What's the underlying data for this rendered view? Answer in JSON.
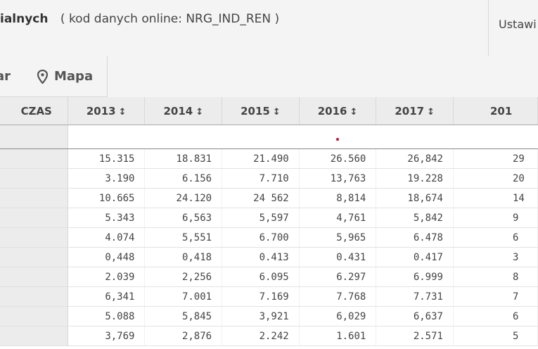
{
  "header": {
    "dataset_name": "ialnych",
    "dataset_code": "( kod danych online: NRG_IND_REN )",
    "settings_label": "Ustawi"
  },
  "toolbar": {
    "prev_tab_label": "ar",
    "map_tab_label": "Mapa"
  },
  "table": {
    "time_header": "CZAS",
    "sort_icon": "↕",
    "columns": [
      "2013",
      "2014",
      "2015",
      "2016",
      "2017",
      "201"
    ],
    "rows": [
      [
        "15.315",
        "18.831",
        "21.490",
        "26.560",
        "26,842",
        "29"
      ],
      [
        "3.190",
        "6.156",
        "7.710",
        "13,763",
        "19.228",
        "20"
      ],
      [
        "10.665",
        "24.120",
        "24 562",
        "8,814",
        "18,674",
        "14"
      ],
      [
        "5.343",
        "6,563",
        "5,597",
        "4,761",
        "5,842",
        "9"
      ],
      [
        "4.074",
        "5,551",
        "6.700",
        "5,965",
        "6.478",
        "6"
      ],
      [
        "0,448",
        "0,418",
        "0.413",
        "0.431",
        "0.417",
        "3"
      ],
      [
        "2.039",
        "2,256",
        "6.095",
        "6.297",
        "6.999",
        "8"
      ],
      [
        "6,341",
        "7.001",
        "7.169",
        "7.768",
        "7.731",
        "7"
      ],
      [
        "5.088",
        "5,845",
        "3,921",
        "6,029",
        "6,637",
        "6"
      ],
      [
        "3,769",
        "2,876",
        "2.242",
        "1.601",
        "2.571",
        "5"
      ]
    ]
  }
}
